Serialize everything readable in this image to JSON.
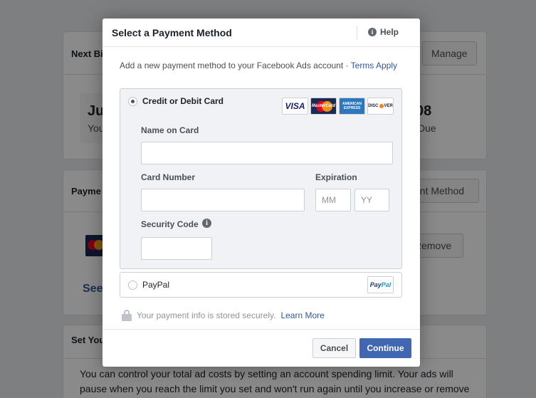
{
  "background": {
    "next_billing": {
      "title": "Next Bi",
      "manage_label": "Manage",
      "date_fragment": "Ju",
      "you_fragment": "You",
      "amount_fragment": "08",
      "due_fragment": "Due"
    },
    "payment_methods": {
      "title": "Payme",
      "add_label": "ent Method",
      "card_fragment": "Mastercard",
      "remove_label": "Remove",
      "see_fragment": "See"
    },
    "spending_limit": {
      "title": "Set You",
      "paragraph_line1": "You can control your total ad costs by setting an account spending limit. Your ads will",
      "paragraph_line2": "pause when you reach the limit you set and won't run again until you increase or remove"
    }
  },
  "dialog": {
    "title": "Select a Payment Method",
    "help_label": "Help",
    "intro_text": "Add a new payment method to your Facebook Ads account · ",
    "terms_link": "Terms Apply",
    "credit_card": {
      "label": "Credit or Debit Card",
      "selected": true,
      "brands": {
        "visa": "VISA",
        "mastercard": "MasterCard",
        "amex_line1": "AMERICAN",
        "amex_line2": "EXPRESS",
        "discover_a": "DISC",
        "discover_b": "VER"
      },
      "name_label": "Name on Card",
      "name_value": "",
      "number_label": "Card Number",
      "number_value": "",
      "expiration_label": "Expiration",
      "month_placeholder": "MM",
      "year_placeholder": "YY",
      "security_label": "Security Code",
      "security_value": ""
    },
    "paypal": {
      "label": "PayPal",
      "logo_a": "Pay",
      "logo_b": "Pal",
      "selected": false
    },
    "secure_text": "Your payment info is stored securely.",
    "learn_more": "Learn More",
    "cancel_label": "Cancel",
    "continue_label": "Continue"
  },
  "colors": {
    "primary": "#4267b2",
    "link": "#365899",
    "overlay": "rgba(0,0,0,0.46)"
  }
}
